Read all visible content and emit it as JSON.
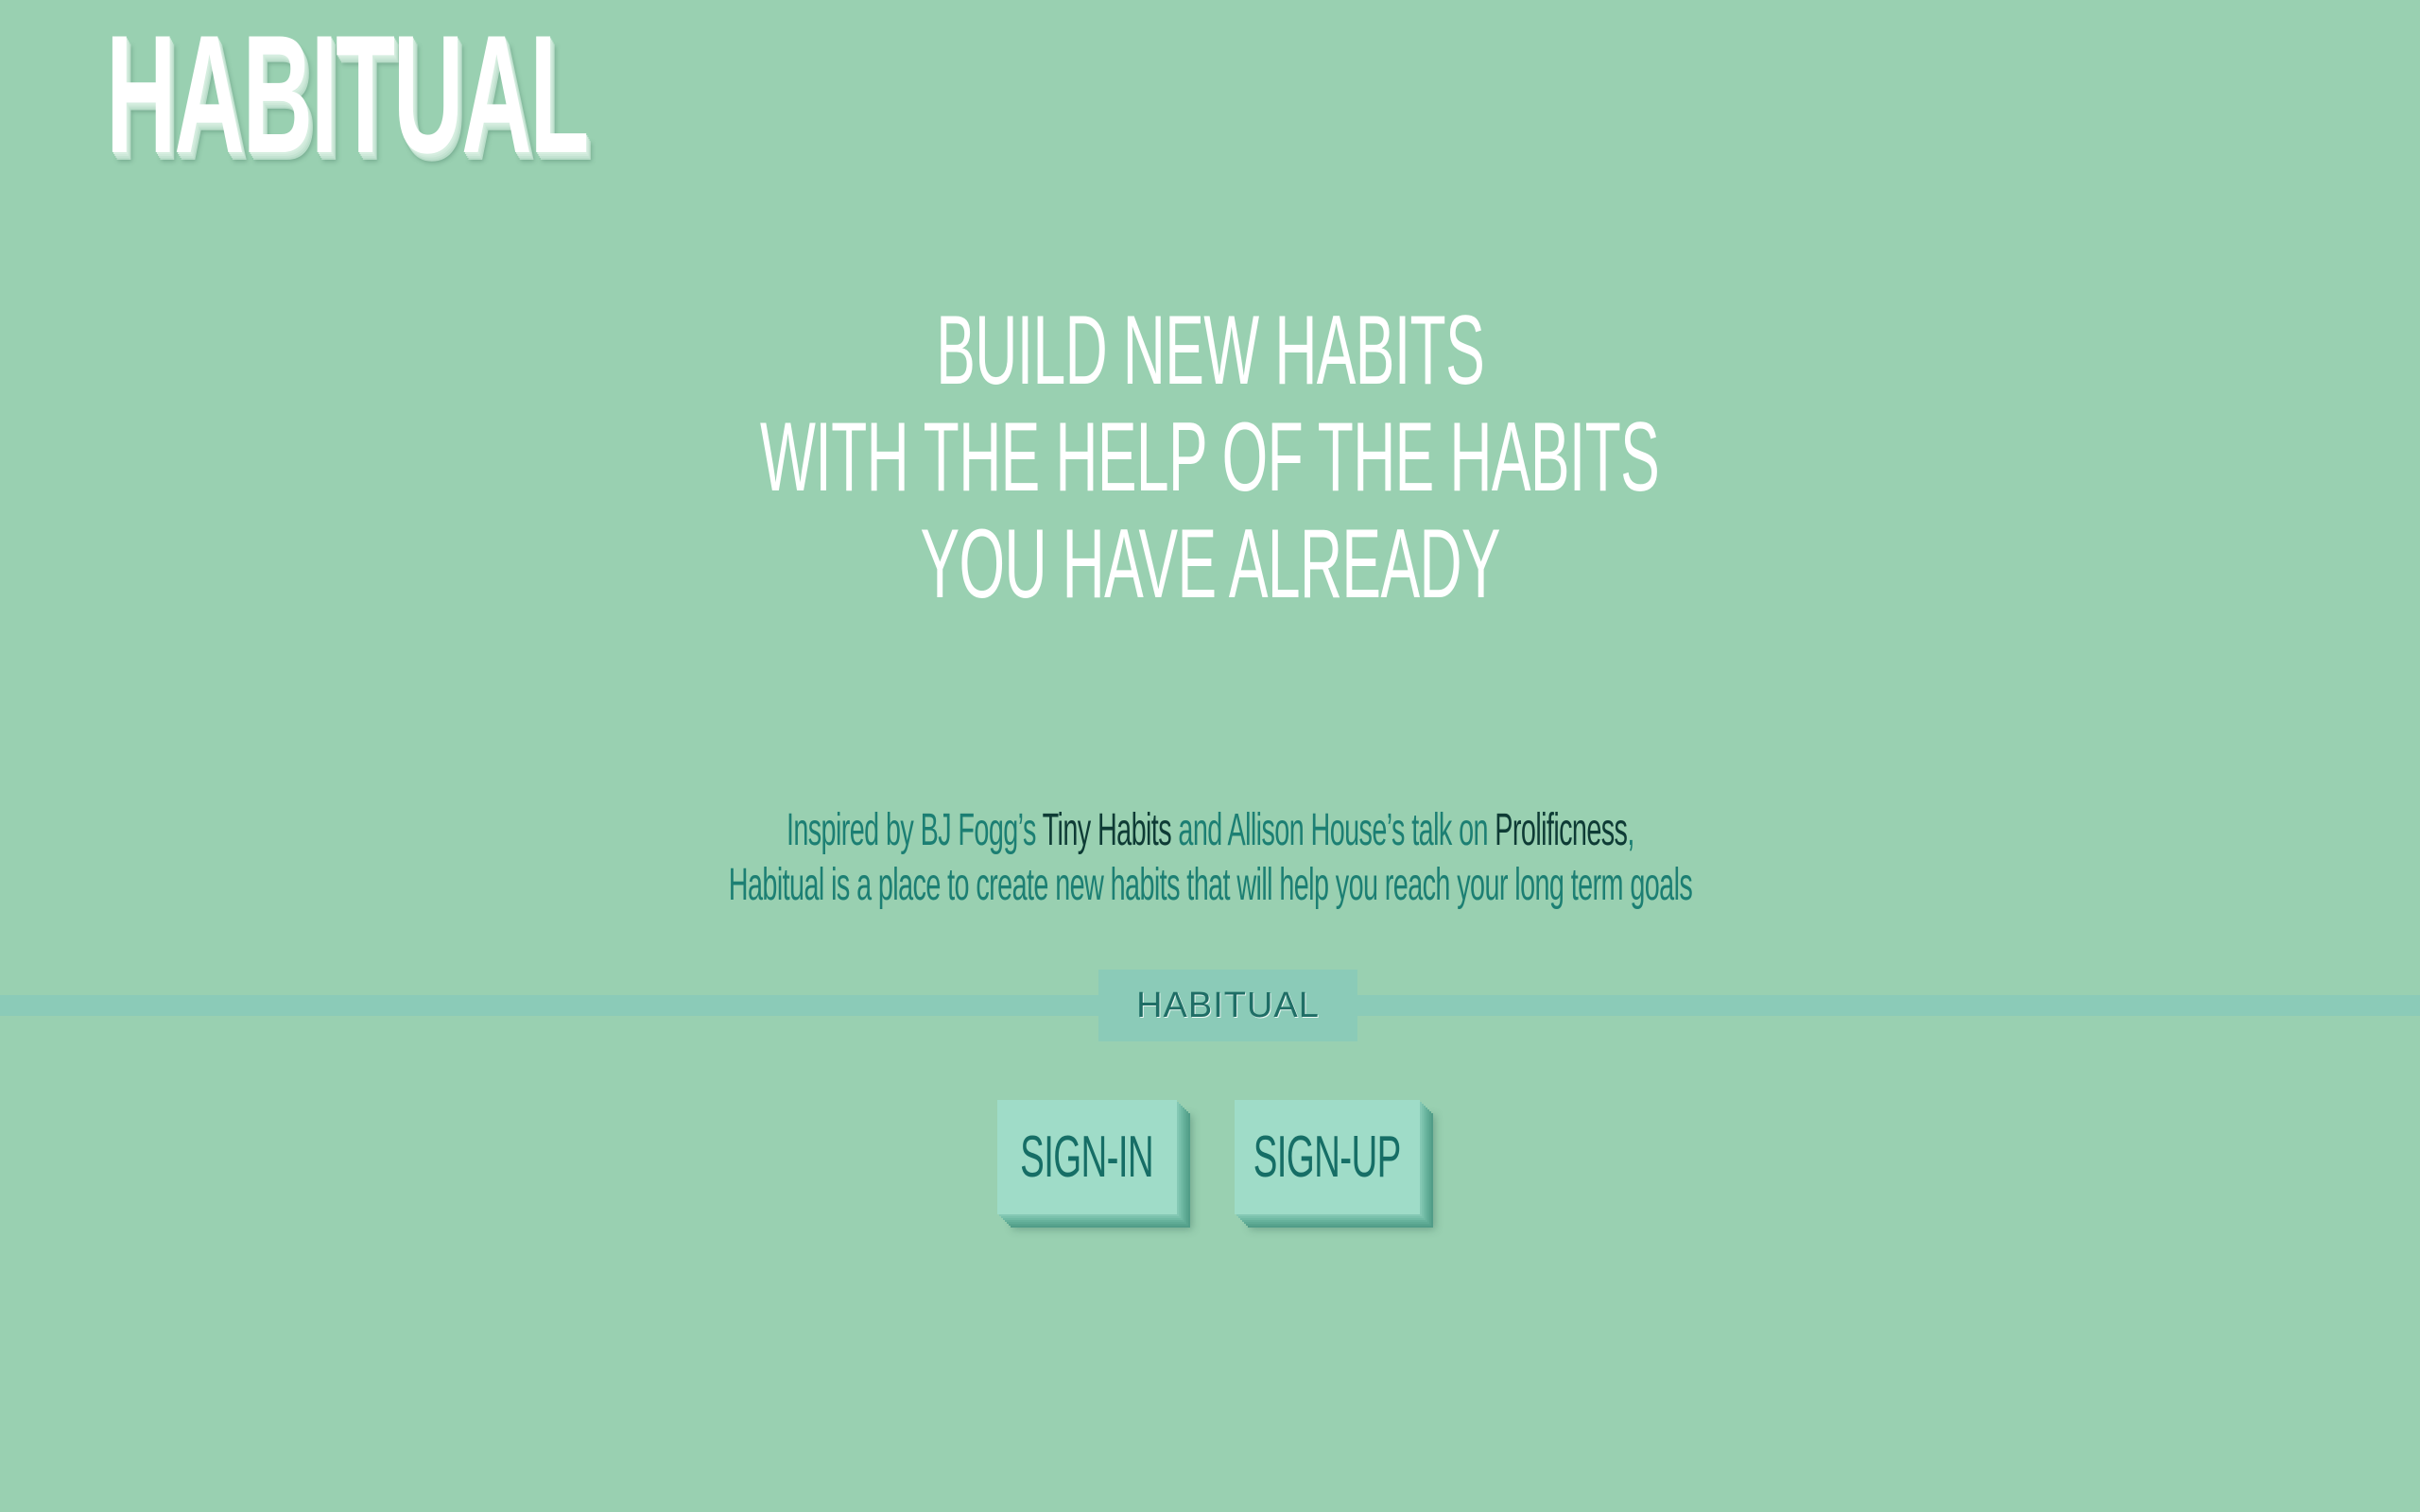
{
  "header": {
    "logo_text": "HABITUAL"
  },
  "hero": {
    "lines": [
      "BUILD NEW HABITS",
      "WITH THE HELP OF THE HABITS",
      "YOU HAVE ALREADY"
    ]
  },
  "tagline": {
    "line1": {
      "prefix": "Inspired by BJ Fogg’s ",
      "link1": "Tiny Habits",
      "middle": " and Allison House’s talk on ",
      "link2": "Prolificness",
      "suffix": ","
    },
    "line2": "Habitual is a place to create new habits that will help you reach your long term goals"
  },
  "divider": {
    "label": "HABITUAL"
  },
  "actions": {
    "signin_label": "SIGN-IN",
    "signup_label": "SIGN-UP"
  },
  "colors": {
    "background": "#99d0b1",
    "text_primary": "#ffffff",
    "accent_teal": "#1c7f73",
    "link_dark": "#0e3b35",
    "button_face": "#9fdcc8",
    "divider": "#8bcbb8"
  }
}
